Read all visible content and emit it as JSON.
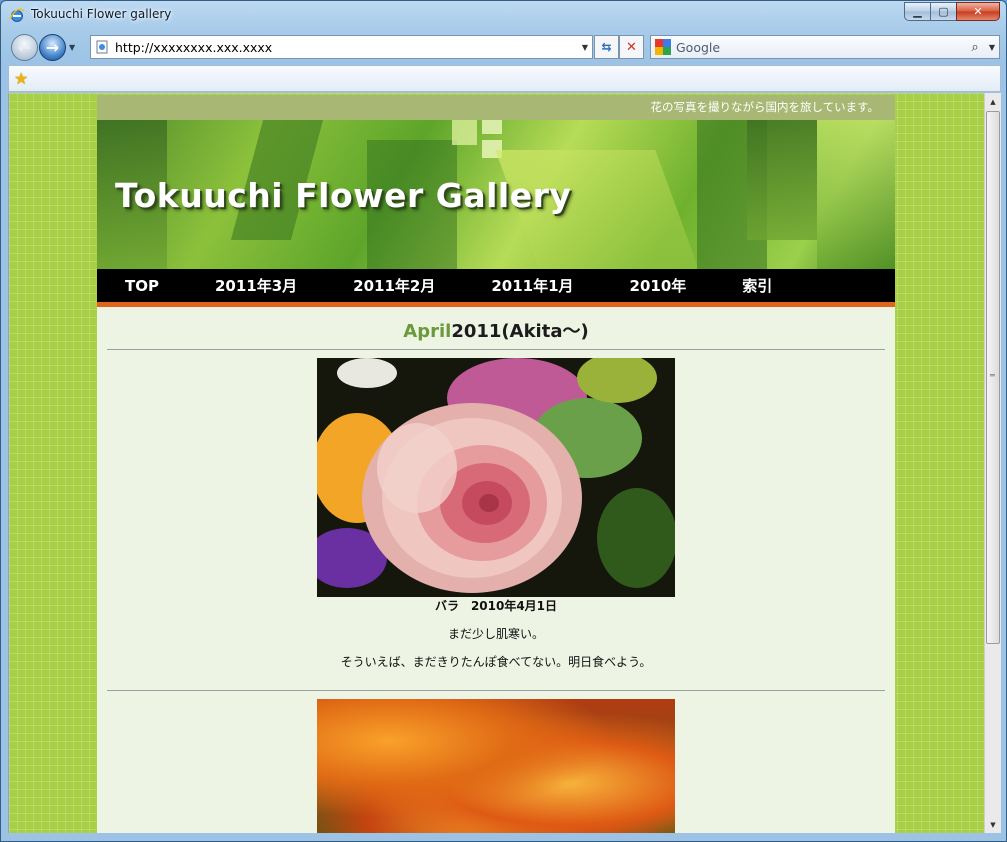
{
  "window": {
    "title": "Tokuuchi Flower gallery"
  },
  "browser": {
    "address": "http://xxxxxxxx.xxx.xxxx",
    "search_placeholder": "Google"
  },
  "site": {
    "tagline": "花の写真を撮りながら国内を旅しています。",
    "banner_title": "Tokuuchi Flower Gallery",
    "nav": [
      "TOP",
      "2011年3月",
      "2011年2月",
      "2011年1月",
      "2010年",
      "索引"
    ]
  },
  "post": {
    "title_accent": "April",
    "title_rest": "2011(Akita～)",
    "caption": "バラ　2010年4月1日",
    "line1": "まだ少し肌寒い。",
    "line2": "そういえば、まだきりたんぽ食べてない。明日食べよう。"
  },
  "colors": {
    "nav_accent": "#e0641a",
    "title_accent": "#6a9a3a",
    "page_bg": "#eef4e4",
    "side_bg": "#a8cf45"
  }
}
